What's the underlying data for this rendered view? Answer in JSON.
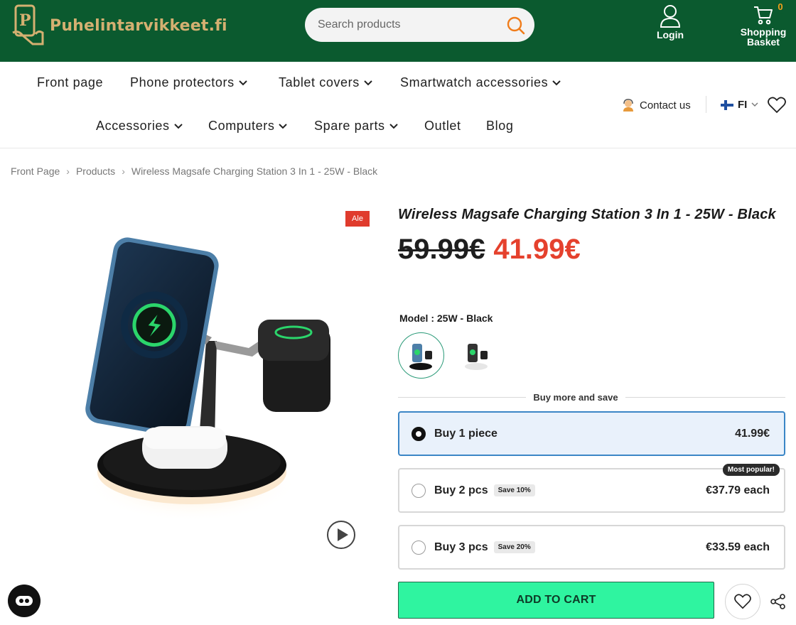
{
  "header": {
    "logo_text": "Puhelintarvikkeet.fi",
    "search_placeholder": "Search products",
    "login_label": "Login",
    "basket_label_1": "Shopping",
    "basket_label_2": "Basket",
    "basket_count": "0"
  },
  "nav": {
    "row1": [
      "Front page",
      "Phone protectors",
      "Tablet covers",
      "Smartwatch accessories"
    ],
    "row2": [
      "Accessories",
      "Computers",
      "Spare parts",
      "Outlet",
      "Blog"
    ],
    "contact": "Contact us",
    "language": "FI"
  },
  "breadcrumb": [
    "Front Page",
    "Products",
    "Wireless Magsafe Charging Station 3 In 1 - 25W - Black"
  ],
  "product": {
    "sale_badge": "Ale",
    "title": "Wireless Magsafe Charging Station 3 In 1 - 25W - Black",
    "old_price": "59.99€",
    "new_price": "41.99€",
    "model_label": "Model : 25W - Black"
  },
  "bundle": {
    "title": "Buy more and save",
    "options": [
      {
        "label": "Buy 1 piece",
        "tag": "",
        "price": "41.99€",
        "selected": true
      },
      {
        "label": "Buy 2 pcs",
        "tag": "Save 10%",
        "price": "€37.79 each",
        "badge": "Most popular!"
      },
      {
        "label": "Buy 3 pcs",
        "tag": "Save 20%",
        "price": "€33.59 each"
      }
    ]
  },
  "actions": {
    "add_to_cart": "ADD TO CART"
  },
  "colors": {
    "header_bg": "#0b5a2f",
    "logo_gold": "#d4b071",
    "sale_red": "#e5412d",
    "cart_green": "#2ff4a0"
  }
}
